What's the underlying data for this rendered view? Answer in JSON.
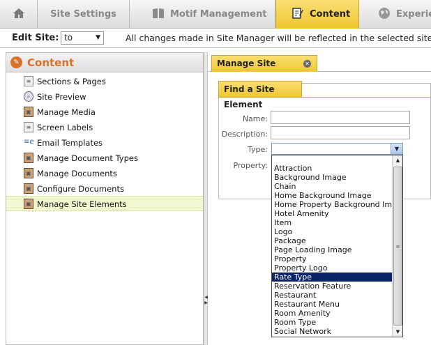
{
  "top_tabs": [
    {
      "label": "",
      "icon": "home-icon"
    },
    {
      "label": "Site Settings",
      "icon": ""
    },
    {
      "label": "Motif Management",
      "icon": "book-icon"
    },
    {
      "label": "Content",
      "icon": "edit-document-icon"
    },
    {
      "label": "Experie",
      "icon": "globe-icon"
    }
  ],
  "edit_site": {
    "label": "Edit Site:",
    "selected": "to",
    "message": "All changes made in Site Manager will be reflected in the selected site."
  },
  "left_panel": {
    "title": "Content",
    "items": [
      {
        "label": "Sections & Pages",
        "icon": "document-icon"
      },
      {
        "label": "Site Preview",
        "icon": "magnifier-icon"
      },
      {
        "label": "Manage Media",
        "icon": "media-icon"
      },
      {
        "label": "Screen Labels",
        "icon": "document-icon"
      },
      {
        "label": "Email Templates",
        "icon": "email-icon"
      },
      {
        "label": "Manage Document Types",
        "icon": "media-icon"
      },
      {
        "label": "Manage Documents",
        "icon": "media-icon"
      },
      {
        "label": "Configure Documents",
        "icon": "media-icon"
      },
      {
        "label": "Manage Site Elements",
        "icon": "media-icon"
      }
    ],
    "selected_index": 8
  },
  "right_panel": {
    "tab_label": "Manage Site Elements",
    "find_tab_label": "Find a Site Element",
    "fields": {
      "name_label": "Name:",
      "description_label": "Description:",
      "type_label": "Type:",
      "property_label": "Property:",
      "name_value": "",
      "description_value": "",
      "type_value": ""
    },
    "type_options": [
      "Attraction",
      "Background Image",
      "Chain",
      "Home Background Image",
      "Home Property Background Image",
      "Hotel Amenity",
      "Item",
      "Logo",
      "Package",
      "Page Loading Image",
      "Property",
      "Property Logo",
      "Rate Type",
      "Reservation Feature",
      "Restaurant",
      "Restaurant Menu",
      "Room Amenity",
      "Room Type",
      "Social Network"
    ],
    "highlighted_option": "Rate Type"
  },
  "colors": {
    "accent_gold": "#efc52f",
    "content_orange": "#d9712b",
    "selected_row": "#f2f7cf",
    "dropdown_highlight": "#0a246a"
  }
}
